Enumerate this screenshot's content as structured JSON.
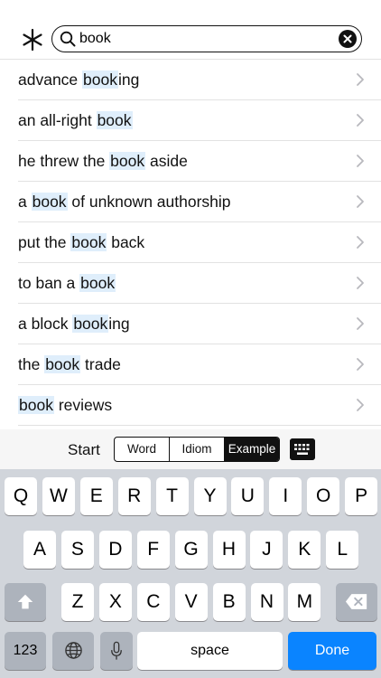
{
  "search": {
    "query": "book"
  },
  "results": [
    {
      "before": "advance ",
      "match": "book",
      "after": "ing"
    },
    {
      "before": "an all-right ",
      "match": "book",
      "after": ""
    },
    {
      "before": "he threw the ",
      "match": "book",
      "after": " aside"
    },
    {
      "before": "a ",
      "match": "book",
      "after": " of unknown authorship"
    },
    {
      "before": "put the ",
      "match": "book",
      "after": " back"
    },
    {
      "before": "to ban a ",
      "match": "book",
      "after": ""
    },
    {
      "before": "a block ",
      "match": "book",
      "after": "ing"
    },
    {
      "before": "the ",
      "match": "book",
      "after": " trade"
    },
    {
      "before": "",
      "match": "book",
      "after": " reviews"
    }
  ],
  "mode_bar": {
    "start_label": "Start",
    "segments": [
      "Word",
      "Idiom",
      "Example"
    ],
    "selected": "Example"
  },
  "keyboard": {
    "row1": [
      "Q",
      "W",
      "E",
      "R",
      "T",
      "Y",
      "U",
      "I",
      "O",
      "P"
    ],
    "row2": [
      "A",
      "S",
      "D",
      "F",
      "G",
      "H",
      "J",
      "K",
      "L"
    ],
    "row3": [
      "Z",
      "X",
      "C",
      "V",
      "B",
      "N",
      "M"
    ],
    "numbers_label": "123",
    "space_label": "space",
    "done_label": "Done"
  },
  "colors": {
    "highlight": "#dfeefb",
    "done_key": "#0a84ff"
  }
}
